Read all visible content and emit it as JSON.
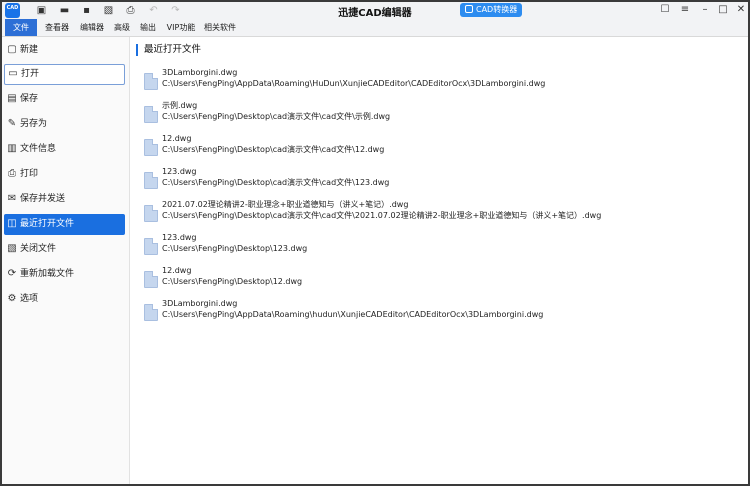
{
  "window": {
    "title": "迅捷CAD编辑器",
    "logo_text": "CAD",
    "converter_label": "CAD转换器"
  },
  "quick_access": [
    {
      "icon": "new-document-icon",
      "glyph": "▣"
    },
    {
      "icon": "open-folder-icon",
      "glyph": "▬"
    },
    {
      "icon": "save-icon",
      "glyph": "▪"
    },
    {
      "icon": "export-pdf-icon",
      "glyph": "▧"
    },
    {
      "icon": "print-icon",
      "glyph": "⎙"
    },
    {
      "icon": "undo-icon",
      "glyph": "↶"
    },
    {
      "icon": "redo-icon",
      "glyph": "↷"
    }
  ],
  "menu": {
    "items": [
      "文件",
      "查看器",
      "编辑器",
      "高级",
      "输出",
      "VIP功能",
      "相关软件"
    ],
    "active": "文件"
  },
  "sidebar": {
    "items": [
      {
        "label": "新建",
        "icon": "new-file-icon",
        "glyph": "▢"
      },
      {
        "label": "打开",
        "icon": "open-folder-icon",
        "glyph": "▭"
      },
      {
        "label": "保存",
        "icon": "save-icon",
        "glyph": "▤"
      },
      {
        "label": "另存为",
        "icon": "save-as-icon",
        "glyph": "✎"
      },
      {
        "label": "文件信息",
        "icon": "file-info-icon",
        "glyph": "▥"
      },
      {
        "label": "打印",
        "icon": "print-icon",
        "glyph": "⎙"
      },
      {
        "label": "保存并发送",
        "icon": "save-send-icon",
        "glyph": "✉"
      },
      {
        "label": "最近打开文件",
        "icon": "recent-files-icon",
        "glyph": "◫"
      },
      {
        "label": "关闭文件",
        "icon": "close-file-icon",
        "glyph": "▧"
      },
      {
        "label": "重新加载文件",
        "icon": "reload-file-icon",
        "glyph": "⟳"
      },
      {
        "label": "选项",
        "icon": "gear-icon",
        "glyph": "⚙"
      }
    ],
    "outlined": "打开",
    "selected": "最近打开文件"
  },
  "main": {
    "section_title": "最近打开文件",
    "files": [
      {
        "name": "3DLamborgini.dwg",
        "path": "C:\\Users\\FengPing\\AppData\\Roaming\\HuDun\\XunjieCADEditor\\CADEditorOcx\\3DLamborgini.dwg"
      },
      {
        "name": "示例.dwg",
        "path": "C:\\Users\\FengPing\\Desktop\\cad演示文件\\cad文件\\示例.dwg"
      },
      {
        "name": "12.dwg",
        "path": "C:\\Users\\FengPing\\Desktop\\cad演示文件\\cad文件\\12.dwg"
      },
      {
        "name": "123.dwg",
        "path": "C:\\Users\\FengPing\\Desktop\\cad演示文件\\cad文件\\123.dwg"
      },
      {
        "name": "2021.07.02理论精讲2-职业理念+职业道德知与（讲义+笔记）.dwg",
        "path": "C:\\Users\\FengPing\\Desktop\\cad演示文件\\cad文件\\2021.07.02理论精讲2-职业理念+职业道德知与（讲义+笔记）.dwg"
      },
      {
        "name": "123.dwg",
        "path": "C:\\Users\\FengPing\\Desktop\\123.dwg"
      },
      {
        "name": "12.dwg",
        "path": "C:\\Users\\FengPing\\Desktop\\12.dwg"
      },
      {
        "name": "3DLamborgini.dwg",
        "path": "C:\\Users\\FengPing\\AppData\\Roaming\\hudun\\XunjieCADEditor\\CADEditorOcx\\3DLamborgini.dwg"
      }
    ]
  },
  "colors": {
    "accent": "#1a6fe0",
    "converter": "#2d8cf0",
    "file_icon": "#c5d6ee"
  }
}
